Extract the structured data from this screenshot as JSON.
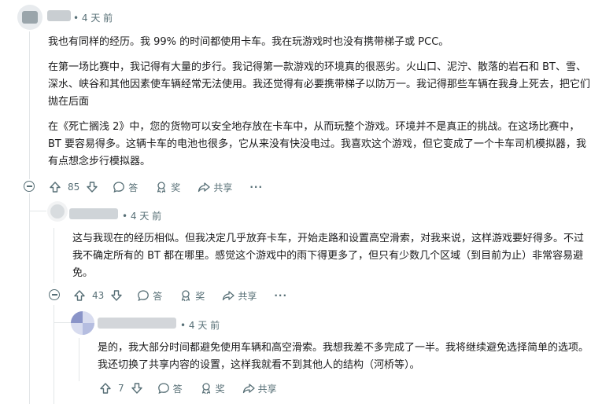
{
  "comments": [
    {
      "time": "4 天 前",
      "paragraphs": [
        "我也有同样的经历。我 99% 的时间都使用卡车。我在玩游戏时也没有携带梯子或 PCC。",
        "在第一场比赛中，我记得有大量的步行。我记得第一款游戏的环境真的很恶劣。火山口、泥泞、散落的岩石和 BT、雪、深水、峡谷和其他因素使车辆经常无法使用。我还觉得有必要携带梯子以防万一。我记得那些车辆在我身上死去，把它们抛在后面",
        "在《死亡搁浅 2》中，您的货物可以安全地存放在卡车中，从而玩整个游戏。环境并不是真正的挑战。在这场比赛中，BT 要容易得多。这辆卡车的电池也很多，它从来没有快没电过。我喜欢这个游戏，但它变成了一个卡车司机模拟器，我有点想念步行模拟器。"
      ],
      "votes": "85",
      "reply_label": "答",
      "award_label": "奖",
      "share_label": "共享",
      "more_label": "···"
    },
    {
      "time": "4 天 前",
      "paragraphs": [
        "这与我现在的经历相似。但我决定几乎放弃卡车，开始走路和设置高空滑索，对我来说，这样游戏要好得多。不过我不确定所有的 BT 都在哪里。感觉这个游戏中的雨下得更多了，但只有少数几个区域（到目前为止）非常容易避免。"
      ],
      "votes": "43",
      "reply_label": "答",
      "award_label": "奖",
      "share_label": "共享",
      "more_label": "···"
    },
    {
      "time": "4 天 前",
      "paragraphs": [
        "是的，我大部分时间都避免使用车辆和高空滑索。我想我差不多完成了一半。我将继续避免选择简单的选项。我还切换了共享内容的设置，这样我就看不到其他人的结构（河桥等）。"
      ],
      "votes": "7",
      "reply_label": "答",
      "award_label": "奖",
      "share_label": "共享"
    }
  ],
  "icons": {
    "upvote": "arrow-up-icon",
    "downvote": "arrow-down-icon",
    "reply": "speech-bubble-icon",
    "award": "award-icon",
    "share": "share-arrow-icon",
    "collapse": "collapse-minus-icon"
  },
  "colors": {
    "text": "#1a1a1b",
    "meta": "#576f76",
    "thread_line": "#e3e6e8"
  }
}
